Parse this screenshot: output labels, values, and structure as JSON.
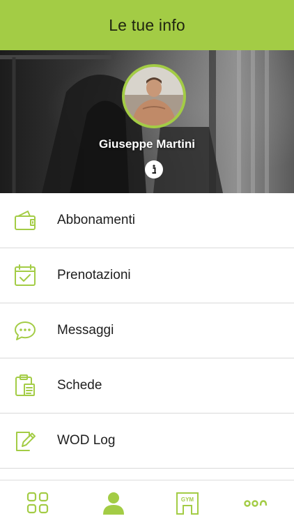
{
  "header": {
    "title": "Le tue info"
  },
  "profile": {
    "name": "Giuseppe Martini",
    "avatar_icon": "user-photo",
    "info_icon": "info-icon"
  },
  "menu": {
    "items": [
      {
        "label": "Abbonamenti",
        "icon": "wallet-icon"
      },
      {
        "label": "Prenotazioni",
        "icon": "calendar-check-icon"
      },
      {
        "label": "Messaggi",
        "icon": "chat-bubble-icon"
      },
      {
        "label": "Schede",
        "icon": "clipboard-icon"
      },
      {
        "label": "WOD Log",
        "icon": "edit-note-icon"
      }
    ]
  },
  "tabbar": {
    "tabs": [
      {
        "icon": "grid-icon"
      },
      {
        "icon": "profile-icon",
        "active": true
      },
      {
        "icon": "gym-icon",
        "label": "GYM"
      },
      {
        "icon": "more-icon"
      }
    ]
  },
  "colors": {
    "accent": "#a3cc45",
    "text": "#1e1e1e",
    "divider": "#d9d9d9"
  }
}
